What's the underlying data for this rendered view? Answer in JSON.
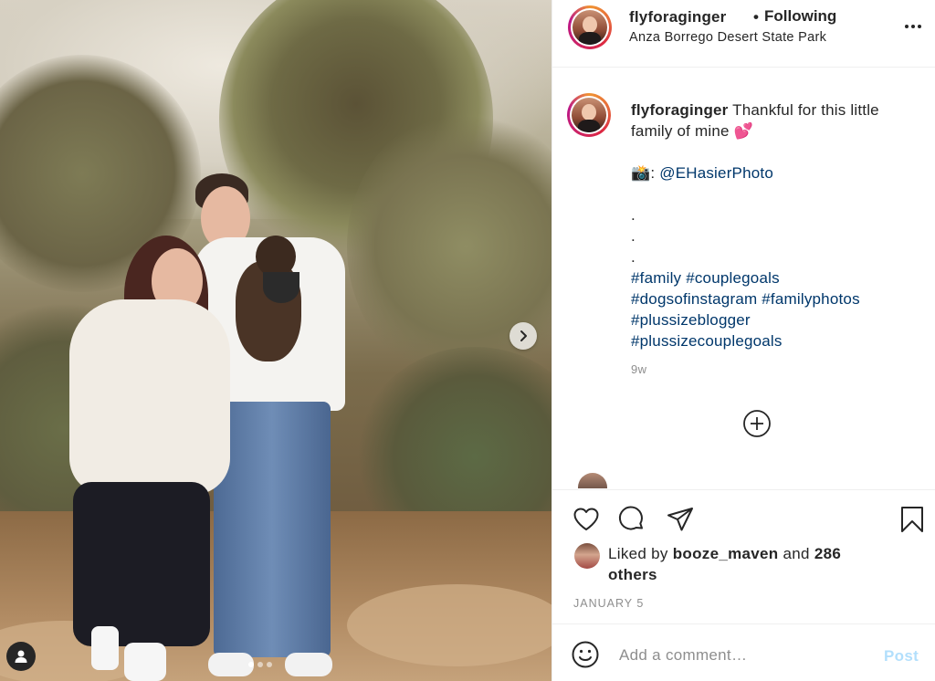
{
  "post": {
    "username": "flyforaginger",
    "follow_separator": "•",
    "follow_status": "Following",
    "location": "Anza Borrego Desert State Park",
    "more_icon": "ellipsis-icon",
    "more_label": "•••"
  },
  "caption": {
    "username": "flyforaginger",
    "line1": "Thankful for this little family of mine 💕",
    "camera_emoji": "📸",
    "photo_credit_prefix": ": ",
    "photo_credit": "@EHasierPhoto",
    "dots": [
      ".",
      ".",
      "."
    ],
    "hashtags": [
      "#family",
      "#couplegoals",
      "#dogsofinstagram",
      "#familyphotos",
      "#plussizeblogger",
      "#plussizecouplegoals"
    ],
    "time_ago": "9w"
  },
  "carousel": {
    "total_slides": 3,
    "active_slide": 1
  },
  "likes": {
    "prefix": "Liked by",
    "liked_by": "booze_maven",
    "connector": "and",
    "others": "286 others"
  },
  "date": "JANUARY 5",
  "comment_box": {
    "placeholder": "Add a comment…",
    "post_label": "Post"
  },
  "colors": {
    "link": "#00376b",
    "muted": "#8e8e8e",
    "post_disabled": "#b2dffc",
    "text": "#262626"
  }
}
